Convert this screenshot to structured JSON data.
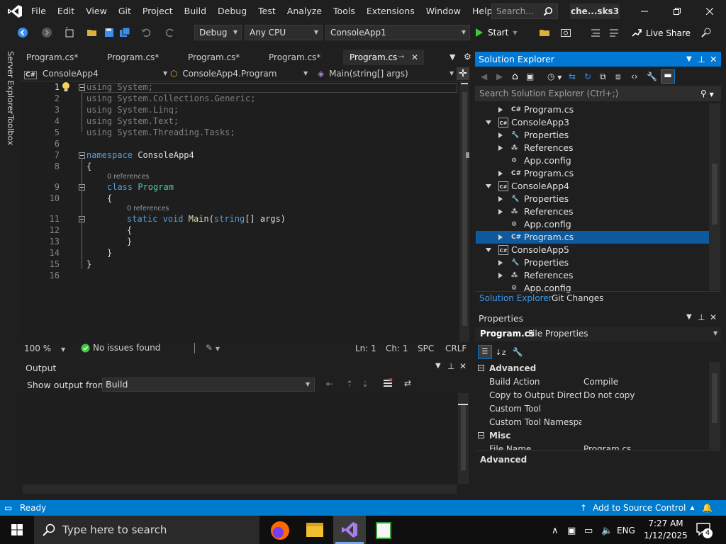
{
  "menu": {
    "items": [
      "File",
      "Edit",
      "View",
      "Git",
      "Project",
      "Build",
      "Debug",
      "Test",
      "Analyze",
      "Tools",
      "Extensions",
      "Window",
      "Help"
    ],
    "search_placeholder": "Search...",
    "solution_name": "che...sks3"
  },
  "toolbar": {
    "config": "Debug",
    "platform": "Any CPU",
    "startup_project": "ConsoleApp1",
    "start_label": "Start",
    "live_share_label": "Live Share"
  },
  "siderail": {
    "server_explorer": "Server Explorer",
    "toolbox": "Toolbox"
  },
  "editor": {
    "tabs": [
      "Program.cs*",
      "Program.cs*",
      "Program.cs*",
      "Program.cs*",
      "Program.cs"
    ],
    "nav": {
      "project": "ConsoleApp4",
      "class": "ConsoleApp4.Program",
      "member": "Main(string[] args)"
    },
    "line_numbers": [
      "1",
      "2",
      "3",
      "4",
      "5",
      "6",
      "7",
      "8",
      "9",
      "10",
      "11",
      "12",
      "13",
      "14",
      "15",
      "16"
    ],
    "codelens_refs": "0 references",
    "code": {
      "using": "using",
      "ns_system": "System;",
      "ns_generic": "System.Collections.Generic;",
      "ns_linq": "System.Linq;",
      "ns_text": "System.Text;",
      "ns_tasks": "System.Threading.Tasks;",
      "namespace_kw": "namespace",
      "namespace_name": "ConsoleApp4",
      "class_kw": "class",
      "class_name": "Program",
      "static_kw": "static",
      "void_kw": "void",
      "main_name": "Main",
      "string_kw": "string",
      "args_rest": "[] args)",
      "open_brace": "{",
      "close_brace": "}"
    },
    "status": {
      "zoom": "100 %",
      "issues": "No issues found",
      "line": "Ln: 1",
      "col": "Ch: 1",
      "spacing": "SPC",
      "eol": "CRLF"
    }
  },
  "output": {
    "title": "Output",
    "show_from_label": "Show output from:",
    "source": "Build"
  },
  "solution_explorer": {
    "title": "Solution Explorer",
    "search_placeholder": "Search Solution Explorer (Ctrl+;)",
    "tree": [
      {
        "label": "Program.cs",
        "icon": "C#",
        "depth": 2,
        "twisty": "closed"
      },
      {
        "label": "ConsoleApp3",
        "icon": "C#",
        "depth": 1,
        "twisty": "open"
      },
      {
        "label": "Properties",
        "icon": "wrench",
        "depth": 2,
        "twisty": "closed"
      },
      {
        "label": "References",
        "icon": "refs",
        "depth": 2,
        "twisty": "closed"
      },
      {
        "label": "App.config",
        "icon": "config",
        "depth": 2,
        "twisty": "none"
      },
      {
        "label": "Program.cs",
        "icon": "C#",
        "depth": 2,
        "twisty": "closed"
      },
      {
        "label": "ConsoleApp4",
        "icon": "C#",
        "depth": 1,
        "twisty": "open"
      },
      {
        "label": "Properties",
        "icon": "wrench",
        "depth": 2,
        "twisty": "closed"
      },
      {
        "label": "References",
        "icon": "refs",
        "depth": 2,
        "twisty": "closed"
      },
      {
        "label": "App.config",
        "icon": "config",
        "depth": 2,
        "twisty": "none"
      },
      {
        "label": "Program.cs",
        "icon": "C#",
        "depth": 2,
        "twisty": "closed",
        "selected": true
      },
      {
        "label": "ConsoleApp5",
        "icon": "C#",
        "depth": 1,
        "twisty": "open"
      },
      {
        "label": "Properties",
        "icon": "wrench",
        "depth": 2,
        "twisty": "closed"
      },
      {
        "label": "References",
        "icon": "refs",
        "depth": 2,
        "twisty": "closed"
      },
      {
        "label": "App.config",
        "icon": "config",
        "depth": 2,
        "twisty": "none"
      }
    ],
    "tab_active": "Solution Explorer",
    "tab_other": "Git Changes"
  },
  "properties": {
    "title": "Properties",
    "object_name": "Program.cs",
    "object_type": "File Properties",
    "category_advanced": "Advanced",
    "category_misc": "Misc",
    "rows": [
      {
        "key": "Build Action",
        "value": "Compile"
      },
      {
        "key": "Copy to Output Director",
        "value": "Do not copy"
      },
      {
        "key": "Custom Tool",
        "value": ""
      },
      {
        "key": "Custom Tool Namespace",
        "value": ""
      }
    ],
    "partial_row": {
      "key": "File Name",
      "value": "Program.cs"
    },
    "description": "Advanced"
  },
  "statusbar": {
    "ready": "Ready",
    "source_control": "Add to Source Control"
  },
  "taskbar": {
    "search_placeholder": "Type here to search",
    "language": "ENG",
    "time": "7:27 AM",
    "date": "1/12/2025",
    "notification_count": "4"
  },
  "colors": {
    "accent": "#0078d4",
    "statusbar": "#007acc",
    "keyword": "#569cd6",
    "type": "#4ec9b0",
    "method": "#dcdcaa"
  }
}
